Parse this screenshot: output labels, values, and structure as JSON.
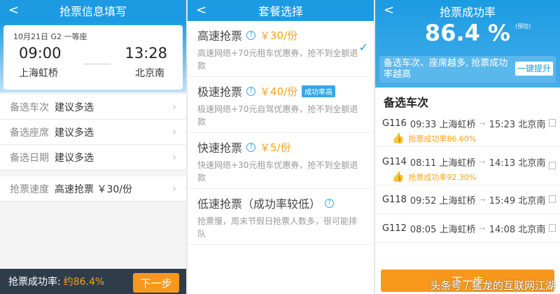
{
  "p1": {
    "title": "抢票信息填写",
    "date": "10月21日  G2  一等座",
    "dep_time": "09:00",
    "arr_time": "13:28",
    "dep_station": "上海虹桥",
    "arr_station": "北京南",
    "rows": [
      {
        "label": "备选车次",
        "value": "建议多选"
      },
      {
        "label": "备选座席",
        "value": "建议多选"
      },
      {
        "label": "备选日期",
        "value": "建议多选"
      }
    ],
    "speed": {
      "label": "抢票速度",
      "value": "高速抢票 ￥30/份"
    },
    "bottom": {
      "label": "抢票成功率:",
      "value": "约86.4%",
      "next": "下一步"
    }
  },
  "p2": {
    "title": "套餐选择",
    "options": [
      {
        "name": "高速抢票",
        "price": "￥30/份",
        "desc": "高速网络+70元租车优惠券，抢不到全额退款",
        "selected": true
      },
      {
        "name": "极速抢票",
        "price": "￥40/份",
        "badge": "成功率高",
        "desc": "极速网络+70元自驾优惠券，抢不到全额退款"
      },
      {
        "name": "快速抢票",
        "price": "￥5/份",
        "desc": "快速网络+30元租车优惠券，抢不到全额退款"
      },
      {
        "name": "低速抢票（成功率较低）",
        "price": "",
        "desc": "抢票慢，周末节假日抢票人数多，很可能排队"
      }
    ]
  },
  "p3": {
    "title": "抢票成功率",
    "rate": "86.4 %",
    "est": "(预估)",
    "tip": "备选车次、座席越多, 抢票成功率越高",
    "boost": "一键提升",
    "heading": "备选车次",
    "trains": [
      {
        "no": "G116",
        "dep": "09:33 上海虹桥",
        "arr": "15:23 北京南",
        "rate": "抢票成功率86.60%"
      },
      {
        "no": "G114",
        "dep": "08:11 上海虹桥",
        "arr": "14:13 北京南",
        "rate": "抢票成功率92.30%"
      },
      {
        "no": "G118",
        "dep": "09:52 上海虹桥",
        "arr": "15:49 北京南"
      },
      {
        "no": "G112",
        "dep": "08:05 上海虹桥",
        "arr": "14:08 北京南"
      }
    ],
    "next": "下一步",
    "watermark": "头条号 / 猛龙的互联网江湖"
  }
}
